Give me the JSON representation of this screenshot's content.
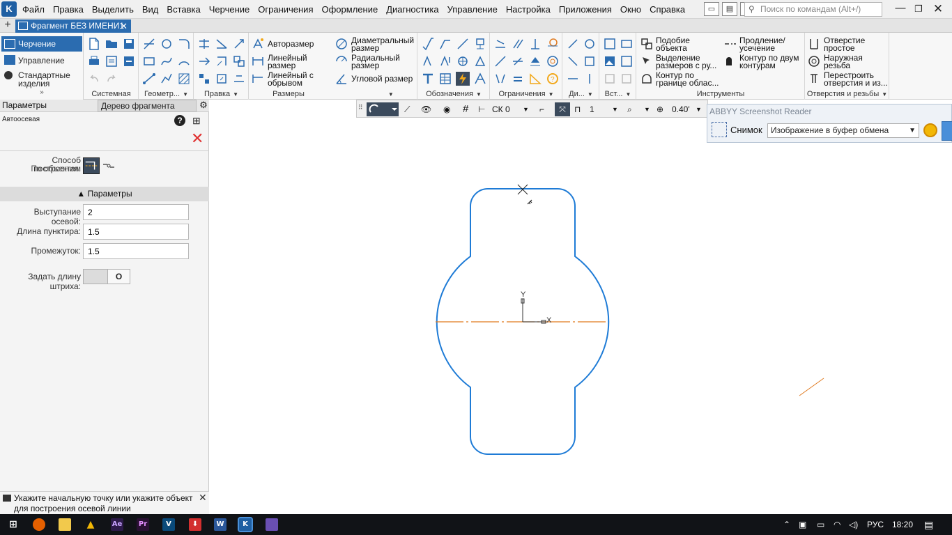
{
  "app": {
    "logo_glyph": "K",
    "accent": "#2b6cb0",
    "curve_color": "#1e7bd6",
    "axis_color": "#e07a1f"
  },
  "menu": [
    "Файл",
    "Правка",
    "Выделить",
    "Вид",
    "Вставка",
    "Черчение",
    "Ограничения",
    "Оформление",
    "Диагностика",
    "Управление",
    "Настройка",
    "Приложения",
    "Окно",
    "Справка"
  ],
  "search": {
    "placeholder": "Поиск по командам (Alt+/)"
  },
  "tabs": {
    "document": "Фрагмент БЕЗ ИМЕНИ1"
  },
  "ribbon": {
    "left_nav": {
      "cherchenie": "Черчение",
      "upravlenie": "Управление",
      "standard_l1": "Стандартные",
      "standard_l2": "изделия",
      "more": "»"
    },
    "groups": {
      "system": "Системная",
      "geometry": "Геометр...",
      "edit": "Правка",
      "dimensions": "Размеры",
      "notation": "Обозначения",
      "constraints": "Ограничения",
      "di": "Ди...",
      "vst": "Вст...",
      "tools": "Инструменты",
      "holes": "Отверстия и резьбы"
    },
    "dims": {
      "auto": "Авторазмер",
      "linear_l1": "Линейный",
      "linear_l2": "размер",
      "linear_break_l1": "Линейный с",
      "linear_break_l2": "обрывом",
      "diam_l1": "Диаметральный",
      "diam_l2": "размер",
      "radial_l1": "Радиальный",
      "radial_l2": "размер",
      "angular": "Угловой размер"
    },
    "tools": {
      "similar_l1": "Подобие",
      "similar_l2": "объекта",
      "select_dims_l1": "Выделение",
      "select_dims_l2": "размеров с ру...",
      "contour_l1": "Контур по",
      "contour_l2": "границе облас...",
      "extend_l1": "Продление/",
      "extend_l2": "усечение",
      "two_contours_l1": "Контур по двум",
      "two_contours_l2": "контурам"
    },
    "holes": {
      "simple_l1": "Отверстие",
      "simple_l2": "простое",
      "thread_l1": "Наружная",
      "thread_l2": "резьба",
      "rebuild_l1": "Перестроить",
      "rebuild_l2": "отверстия и из..."
    }
  },
  "left_panel": {
    "tab_params": "Параметры",
    "tab_tree": "Дерево фрагмента",
    "command": "Автоосевая",
    "method_label": "Способ построения:",
    "method_value": "По объектам",
    "section": "Параметры",
    "fields": {
      "protrusion_label": "Выступание осевой:",
      "protrusion_value": "2",
      "dash_label": "Длина пунктира:",
      "dash_value": "1.5",
      "gap_label": "Промежуток:",
      "gap_value": "1.5",
      "stroke_label": "Задать длину штриха:",
      "stroke_knob": "O"
    },
    "hint": "Укажите начальную точку или укажите объект для построения осевой линии"
  },
  "viewbar": {
    "cs": "СК 0",
    "layer": "1",
    "zoom": "0.40'"
  },
  "canvas": {
    "axis_y": "Y",
    "axis_x": "X"
  },
  "abbyy": {
    "title": "ABBYY Screenshot Reader",
    "snap_label": "Снимок",
    "snap_target": "Изображение в буфер обмена"
  },
  "taskbar": {
    "lang": "РУС",
    "time": "18:20"
  }
}
